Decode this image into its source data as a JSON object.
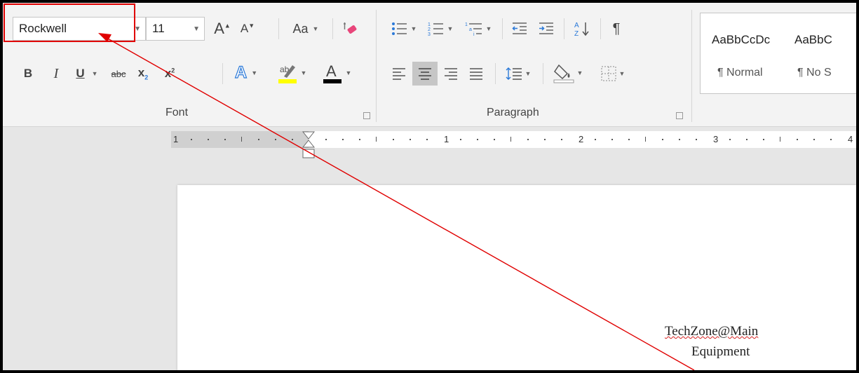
{
  "font": {
    "name_value": "Rockwell",
    "size_value": "11",
    "change_case_label": "Aa",
    "group_label": "Font"
  },
  "paragraph": {
    "group_label": "Paragraph"
  },
  "styles": {
    "items": [
      {
        "preview": "AaBbCcDc",
        "name": "¶ Normal"
      },
      {
        "preview": "AaBbC",
        "name": "¶ No S"
      }
    ]
  },
  "ruler": {
    "numbers": [
      "1",
      "1",
      "2",
      "3",
      "4"
    ]
  },
  "document": {
    "line1": "TechZone@Main",
    "line2": "Equipment"
  },
  "colors": {
    "highlight": "#ffff00",
    "font_color": "#000000",
    "text_effects": "#2b79d8",
    "annotation": "#ff0000"
  }
}
